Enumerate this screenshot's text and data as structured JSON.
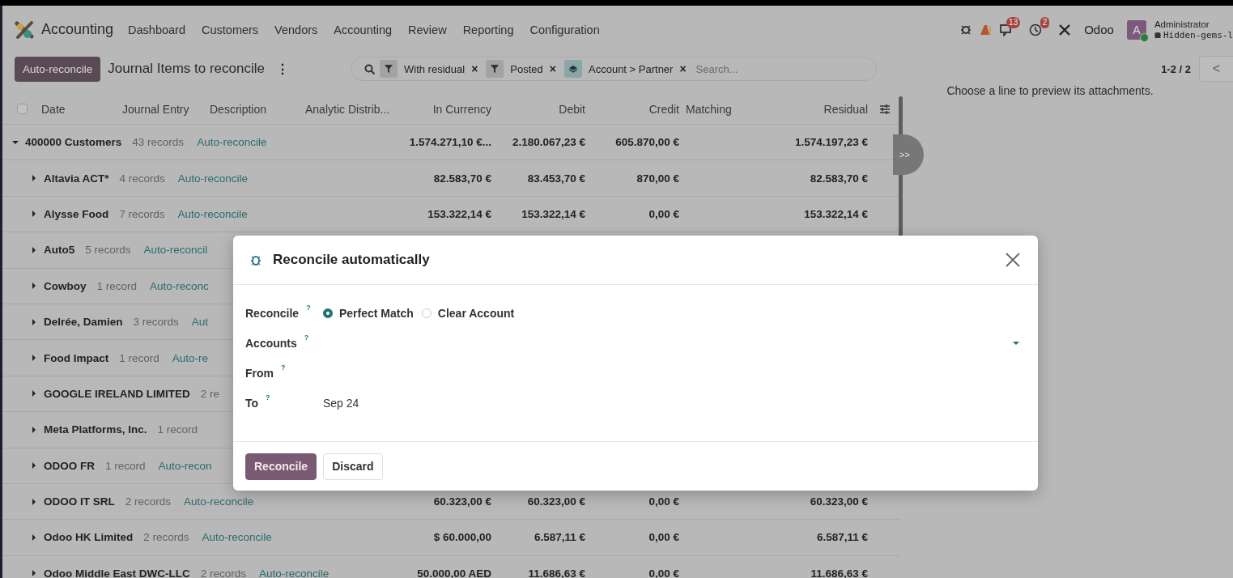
{
  "navbar": {
    "app_name": "Accounting",
    "menu": [
      "Dashboard",
      "Customers",
      "Vendors",
      "Accounting",
      "Review",
      "Reporting",
      "Configuration"
    ],
    "systray": {
      "messages_badge": "13",
      "activities_badge": "2",
      "company": "Odoo",
      "avatar_letter": "A",
      "user_name": "Administrator",
      "database": "Hidden-gems-l"
    }
  },
  "control_panel": {
    "action_button": "Auto-reconcile",
    "title": "Journal Items to reconcile",
    "menu_glyph": "⋮",
    "facets": [
      {
        "kind": "filter",
        "label": "With residual",
        "remove": "×"
      },
      {
        "kind": "filter",
        "label": "Posted",
        "remove": "×"
      },
      {
        "kind": "groupby",
        "label": "Account > Partner",
        "remove": "×"
      }
    ],
    "search": {
      "placeholder": "Search..."
    },
    "pager": "1-2 / 2",
    "prev_glyph": "<"
  },
  "table": {
    "select_all": {
      "checked": false
    },
    "columns": [
      "Date",
      "Journal Entry",
      "Description",
      "Analytic Distrib...",
      "In Currency",
      "Debit",
      "Credit",
      "Matching",
      "Residual"
    ],
    "rows": [
      {
        "label": "400000 Customers",
        "count": "43 records",
        "action": "Auto-reconcile",
        "expanded": true,
        "in_currency": "1.574.271,10 €...",
        "debit": "2.180.067,23 €",
        "credit": "605.870,00 €",
        "residual": "1.574.197,23 €",
        "children": [
          {
            "label": "Altavia ACT*",
            "count": "4 records",
            "action": "Auto-reconcile",
            "expanded": false,
            "in_currency": "82.583,70 €",
            "debit": "83.453,70 €",
            "credit": "870,00 €",
            "residual": "82.583,70 €"
          },
          {
            "label": "Alysse Food",
            "count": "7 records",
            "action": "Auto-reconcile",
            "expanded": false,
            "in_currency": "153.322,14 €",
            "debit": "153.322,14 €",
            "credit": "0,00 €",
            "residual": "153.322,14 €"
          },
          {
            "label": "Auto5",
            "count": "5 records",
            "action": "Auto-reconcil",
            "expanded": false
          },
          {
            "label": "Cowboy",
            "count": "1 record",
            "action": "Auto-reconc",
            "expanded": false
          },
          {
            "label": "Delrée, Damien",
            "count": "3 records",
            "action": "Aut",
            "expanded": false
          },
          {
            "label": "Food Impact",
            "count": "1 record",
            "action": "Auto-re",
            "expanded": false
          },
          {
            "label": "GOOGLE IRELAND LIMITED",
            "count": "2 re",
            "expanded": false
          },
          {
            "label": "Meta Platforms, Inc.",
            "count": "1 record",
            "expanded": false
          },
          {
            "label": "ODOO FR",
            "count": "1 record",
            "action": "Auto-recon",
            "expanded": false
          },
          {
            "label": "ODOO IT SRL",
            "count": "2 records",
            "action": "Auto-reconcile",
            "expanded": false,
            "in_currency": "60.323,00 €",
            "debit": "60.323,00 €",
            "credit": "0,00 €",
            "residual": "60.323,00 €"
          },
          {
            "label": "Odoo HK Limited",
            "count": "2 records",
            "action": "Auto-reconcile",
            "expanded": false,
            "in_currency": "$ 60.000,00",
            "debit": "6.587,11 €",
            "credit": "0,00 €",
            "residual": "6.587,11 €"
          },
          {
            "label": "Odoo Middle East DWC-LLC",
            "count": "2 records",
            "action": "Auto-reconcile",
            "expanded": false,
            "in_currency": "50.000,00 AED",
            "debit": "11.686,63 €",
            "credit": "0,00 €",
            "residual": "11.686,63 €"
          }
        ]
      }
    ]
  },
  "preview_toggle": ">>",
  "side_panel": {
    "message": "Choose a line to preview its attachments."
  },
  "dialog": {
    "title": "Reconcile automatically",
    "fields": [
      {
        "kind": "radio",
        "label": "Reconcile",
        "help": "?",
        "options": [
          {
            "label": "Perfect Match",
            "selected": true
          },
          {
            "label": "Clear Account",
            "selected": false
          }
        ]
      },
      {
        "kind": "select",
        "label": "Accounts",
        "help": "?"
      },
      {
        "kind": "date",
        "label": "From",
        "help": "?"
      },
      {
        "kind": "date",
        "label": "To",
        "help": "?",
        "value": "Sep 24"
      }
    ],
    "buttons": [
      {
        "kind": "primary",
        "label": "Reconcile"
      },
      {
        "kind": "secondary",
        "label": "Discard"
      }
    ]
  }
}
